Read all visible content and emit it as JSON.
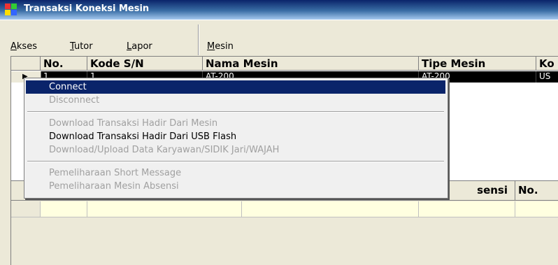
{
  "window": {
    "title": "Transaksi Koneksi Mesin"
  },
  "menu": [
    {
      "label": "Akses",
      "accel": "A",
      "rest": "kses"
    },
    {
      "label": "Tutor",
      "accel": "T",
      "rest": "utor"
    },
    {
      "label": "Lapor",
      "accel": "L",
      "rest": "apor"
    },
    {
      "label": "Mesin",
      "accel": "M",
      "rest": "esin"
    }
  ],
  "grid_top": {
    "columns": [
      "No.",
      "Kode S/N",
      "Nama Mesin",
      "Tipe Mesin",
      "Ko"
    ],
    "rows": [
      {
        "no": "1",
        "kode": "1",
        "nama": "AT-200",
        "tipe": "AT-200",
        "ko": "US"
      }
    ]
  },
  "grid_bottom": {
    "columns": [
      "",
      "",
      "...",
      "sensi",
      "No."
    ]
  },
  "context_menu": {
    "items": [
      {
        "label": "Connect",
        "state": "selected"
      },
      {
        "label": "Disconnect",
        "state": "disabled"
      },
      {
        "label": "Download Transaksi Hadir Dari Mesin",
        "state": "disabled"
      },
      {
        "label": "Download Transaksi Hadir Dari USB Flash",
        "state": "enabled"
      },
      {
        "label": "Download/Upload Data Karyawan/SIDIK Jari/WAJAH",
        "state": "disabled"
      },
      {
        "label": "Pemeliharaan Short Message",
        "state": "disabled"
      },
      {
        "label": "Pemeliharaan Mesin Absensi",
        "state": "disabled"
      }
    ]
  },
  "colors": {
    "selection": "#0a246a",
    "grid_row_bg": "#000000",
    "input_row_bg": "#ffffe0"
  }
}
